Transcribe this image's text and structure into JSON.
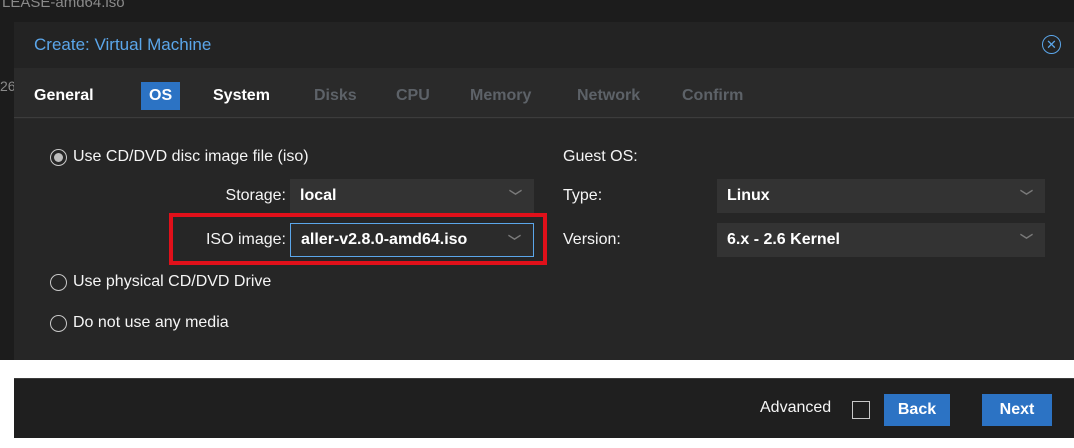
{
  "background": {
    "filename_fragment": "LEASE-amd64.iso",
    "side_fragment": "26"
  },
  "dialog": {
    "title": "Create: Virtual Machine",
    "close_glyph": "✕"
  },
  "tabs": [
    {
      "label": "General",
      "state": "enabled"
    },
    {
      "label": "OS",
      "state": "active"
    },
    {
      "label": "System",
      "state": "enabled"
    },
    {
      "label": "Disks",
      "state": "disabled"
    },
    {
      "label": "CPU",
      "state": "disabled"
    },
    {
      "label": "Memory",
      "state": "disabled"
    },
    {
      "label": "Network",
      "state": "disabled"
    },
    {
      "label": "Confirm",
      "state": "disabled"
    }
  ],
  "media": {
    "option_iso": "Use CD/DVD disc image file (iso)",
    "option_physical": "Use physical CD/DVD Drive",
    "option_none": "Do not use any media",
    "selected": "iso",
    "storage_label": "Storage:",
    "storage_value": "local",
    "iso_label": "ISO image:",
    "iso_value": "aller-v2.8.0-amd64.iso"
  },
  "guest_os": {
    "heading": "Guest OS:",
    "type_label": "Type:",
    "type_value": "Linux",
    "version_label": "Version:",
    "version_value": "6.x - 2.6 Kernel"
  },
  "footer": {
    "advanced_label": "Advanced",
    "advanced_checked": false,
    "back_label": "Back",
    "next_label": "Next"
  },
  "colors": {
    "accent": "#2c73c4",
    "title": "#5ba6ea",
    "highlight": "#e0101a"
  },
  "icons": {
    "dropdown": "chevron-down-icon",
    "close": "close-circle-icon"
  }
}
